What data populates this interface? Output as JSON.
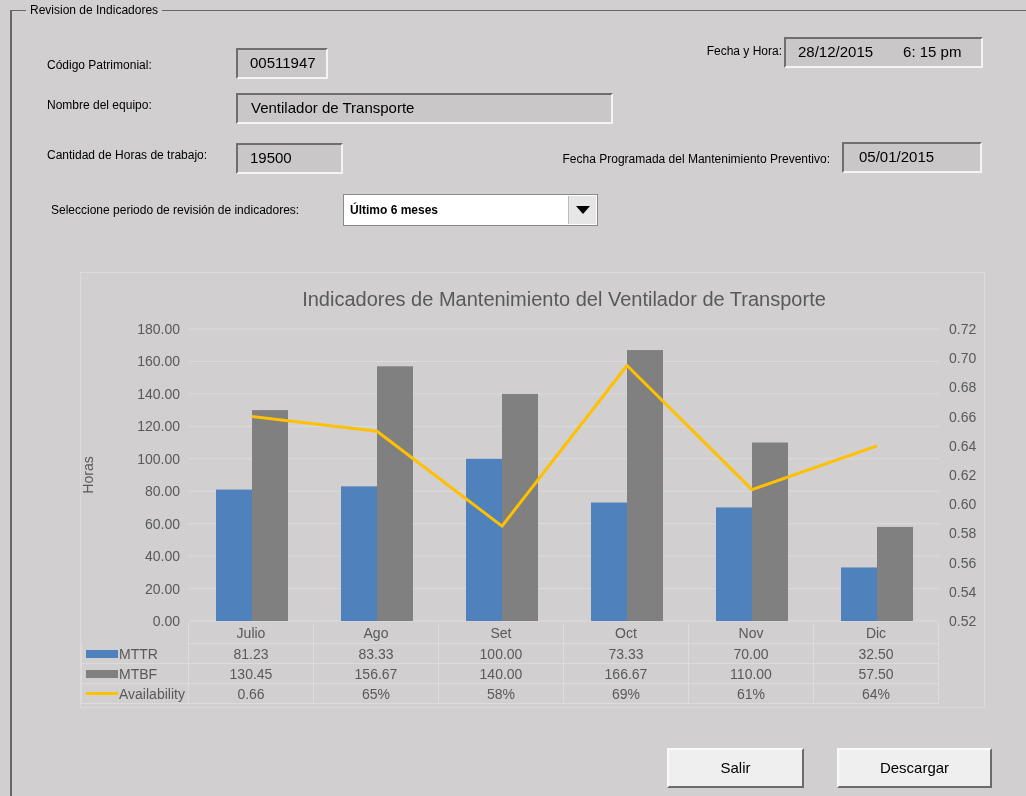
{
  "frame": {
    "legend": "Revision de Indicadores"
  },
  "codigo": {
    "label": "Código Patrimonial:",
    "value": "00511947"
  },
  "fecha_hora": {
    "label": "Fecha y Hora:",
    "date": "28/12/2015",
    "time": "6: 15 pm"
  },
  "nombre": {
    "label": "Nombre del equipo:",
    "value": "Ventilador de Transporte"
  },
  "horas": {
    "label": "Cantidad de Horas de trabajo:",
    "value": "19500"
  },
  "fecha_programada": {
    "label": "Fecha Programada del Mantenimiento Preventivo:",
    "value": "05/01/2015"
  },
  "period_select": {
    "label": "Seleccione periodo de revisión de indicadores:",
    "value": "Último 6 meses"
  },
  "chart": {
    "chart_data": {
      "type": "bar",
      "title": "Indicadores de Mantenimiento del Ventilador de Transporte",
      "ylabel": "Horas",
      "categories": [
        "Julio",
        "Ago",
        "Set",
        "Oct",
        "Nov",
        "Dic"
      ],
      "series": [
        {
          "name": "MTTR",
          "color": "#4f81bd",
          "type": "bar",
          "values": [
            81,
            83,
            100,
            73,
            70,
            33
          ]
        },
        {
          "name": "MTBF",
          "color": "#808080",
          "type": "bar",
          "values": [
            130,
            157,
            140,
            167,
            110,
            58
          ]
        },
        {
          "name": "Availability",
          "color": "#ffc000",
          "type": "line",
          "axis": "y2",
          "values": [
            0.66,
            0.65,
            0.585,
            0.695,
            0.61,
            0.64
          ]
        }
      ],
      "grid": true,
      "legend": "bottom",
      "ylim": [
        0,
        180
      ],
      "yticks": [
        {
          "value": 0,
          "label": "0.00"
        },
        {
          "value": 20,
          "label": "20.00"
        },
        {
          "value": 40,
          "label": "40.00"
        },
        {
          "value": 60,
          "label": "60.00"
        },
        {
          "value": 80,
          "label": "80.00"
        },
        {
          "value": 100,
          "label": "100.00"
        },
        {
          "value": 120,
          "label": "120.00"
        },
        {
          "value": 140,
          "label": "140.00"
        },
        {
          "value": 160,
          "label": "160.00"
        },
        {
          "value": 180,
          "label": "180.00"
        }
      ],
      "y2lim": [
        0.52,
        0.72
      ],
      "y2ticks": [
        {
          "value": 0.52,
          "label": "0.52"
        },
        {
          "value": 0.54,
          "label": "0.54"
        },
        {
          "value": 0.56,
          "label": "0.56"
        },
        {
          "value": 0.58,
          "label": "0.58"
        },
        {
          "value": 0.6,
          "label": "0.60"
        },
        {
          "value": 0.62,
          "label": "0.62"
        },
        {
          "value": 0.64,
          "label": "0.64"
        },
        {
          "value": 0.66,
          "label": "0.66"
        },
        {
          "value": 0.68,
          "label": "0.68"
        },
        {
          "value": 0.7,
          "label": "0.70"
        },
        {
          "value": 0.72,
          "label": "0.72"
        }
      ]
    },
    "data_table": [
      [
        "81.23",
        "83.33",
        "100.00",
        "73.33",
        "70.00",
        "32.50"
      ],
      [
        "130.45",
        "156.67",
        "140.00",
        "166.67",
        "110.00",
        "57.50"
      ],
      [
        "0.66",
        "65%",
        "58%",
        "69%",
        "61%",
        "64%"
      ]
    ]
  },
  "buttons": [
    {
      "label": "Salir"
    },
    {
      "label": "Descargar"
    }
  ]
}
